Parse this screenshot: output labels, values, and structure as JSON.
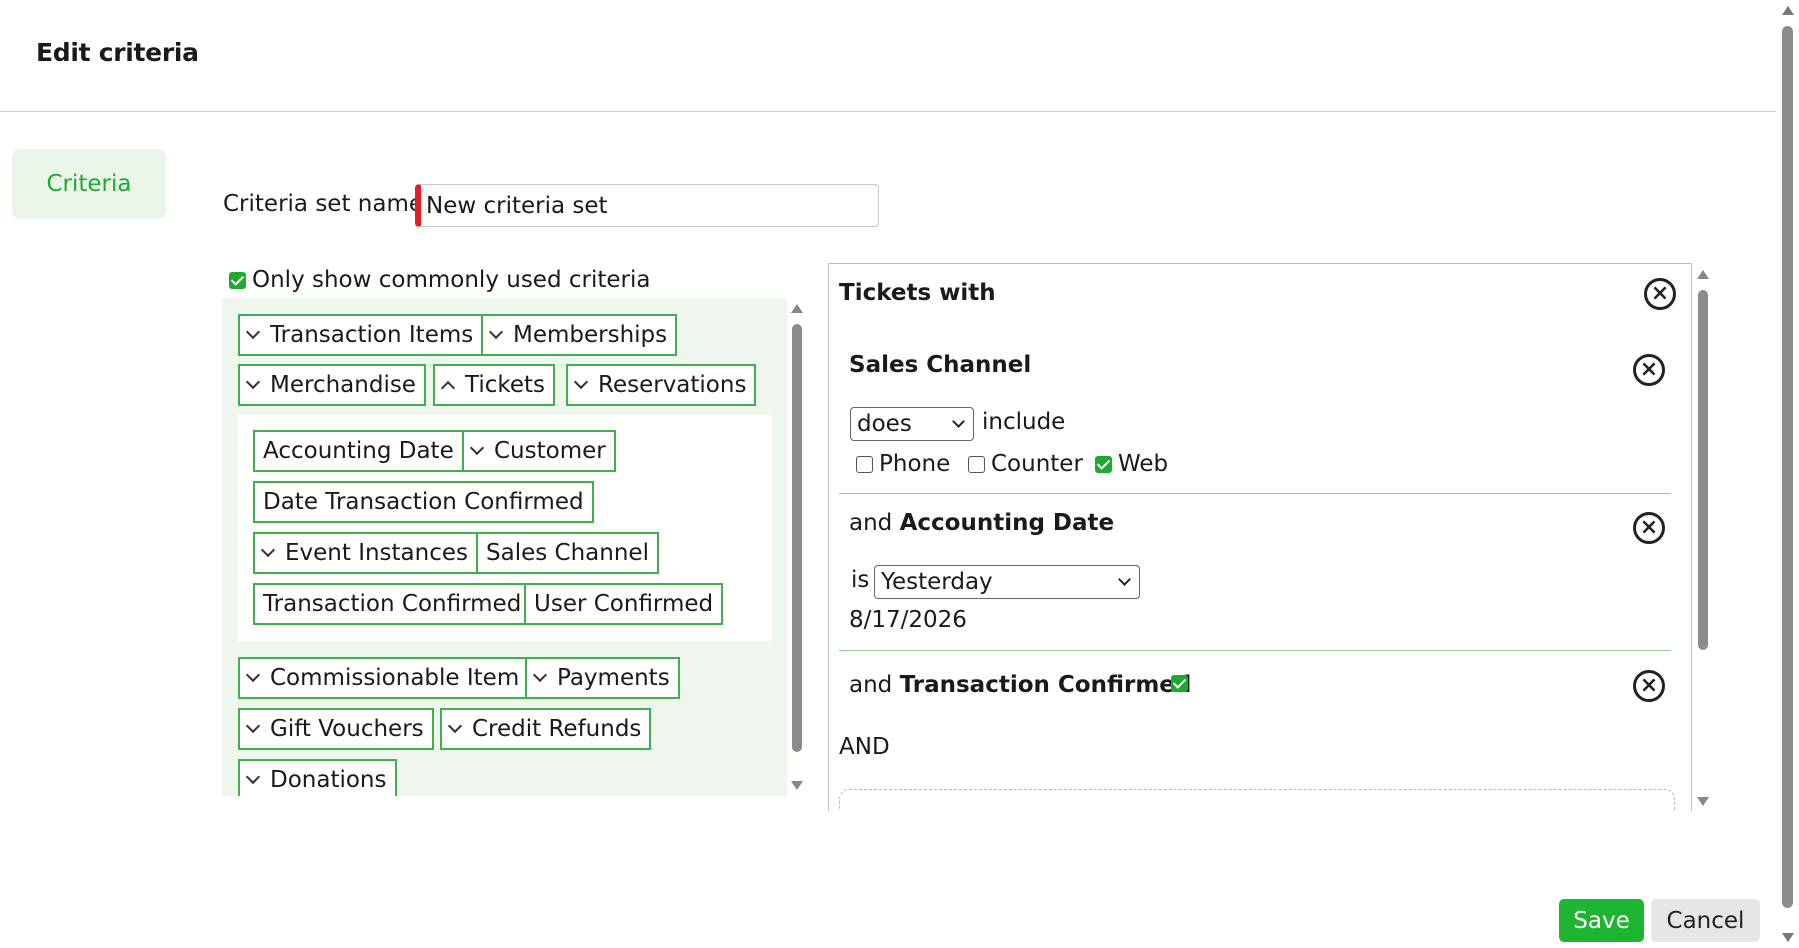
{
  "dialog": {
    "title": "Edit criteria"
  },
  "nav": {
    "criteria_label": "Criteria"
  },
  "form": {
    "set_name_label": "Criteria set name:",
    "set_name_value": "New criteria set",
    "common_only_label": "Only show commonly used criteria",
    "common_only_checked": true
  },
  "categories": {
    "transaction_items": "Transaction Items",
    "memberships": "Memberships",
    "merchandise": "Merchandise",
    "tickets": "Tickets",
    "reservations": "Reservations",
    "commissionable_item": "Commissionable Item",
    "payments": "Payments",
    "gift_vouchers": "Gift Vouchers",
    "credit_refunds": "Credit Refunds",
    "donations": "Donations"
  },
  "ticket_fields": {
    "accounting_date": "Accounting Date",
    "customer": "Customer",
    "date_transaction_confirmed": "Date Transaction Confirmed",
    "event_instances": "Event Instances",
    "sales_channel": "Sales Channel",
    "transaction_confirmed": "Transaction Confirmed",
    "user_confirmed": "User Confirmed"
  },
  "builder": {
    "heading": "Tickets with",
    "sales_channel": {
      "title": "Sales Channel",
      "operator": "does",
      "verb": "include",
      "options": [
        {
          "label": "Phone",
          "checked": false
        },
        {
          "label": "Counter",
          "checked": false
        },
        {
          "label": "Web",
          "checked": true
        }
      ]
    },
    "accounting_date": {
      "prefix": "and",
      "title": "Accounting Date",
      "is_label": "is",
      "value": "Yesterday",
      "resolved_date": "8/17/2026"
    },
    "transaction_confirmed": {
      "prefix": "and",
      "title": "Transaction Confirmed",
      "checked": true
    },
    "joiner": "AND"
  },
  "footer": {
    "save_label": "Save",
    "cancel_label": "Cancel"
  },
  "colors": {
    "accent": "#1eaa2e",
    "chip_border": "#3fb04c",
    "panel_bg": "#eef6ee",
    "required": "#e51c23"
  }
}
